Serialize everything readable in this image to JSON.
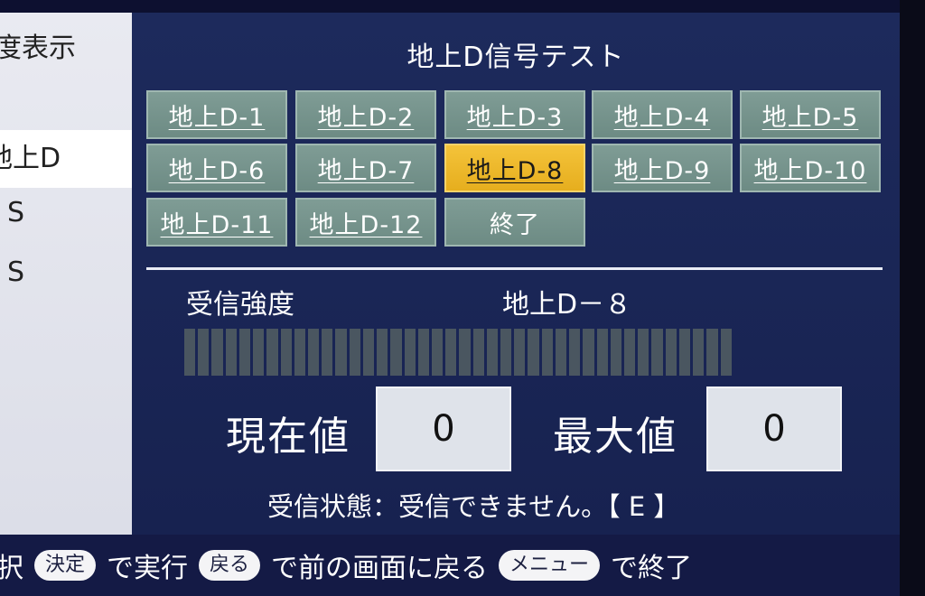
{
  "sidebar": {
    "items": [
      {
        "label": "度表示"
      },
      {
        "label": "地上D"
      },
      {
        "label": "S"
      },
      {
        "label": "S"
      }
    ]
  },
  "panel": {
    "title": "地上D信号テスト",
    "buttons": [
      {
        "label": "地上D-1"
      },
      {
        "label": "地上D-2"
      },
      {
        "label": "地上D-3"
      },
      {
        "label": "地上D-4"
      },
      {
        "label": "地上D-5"
      },
      {
        "label": "地上D-6"
      },
      {
        "label": "地上D-7"
      },
      {
        "label": "地上D-8"
      },
      {
        "label": "地上D-9"
      },
      {
        "label": "地上D-10"
      },
      {
        "label": "地上D-11"
      },
      {
        "label": "地上D-12"
      },
      {
        "label": "終了"
      }
    ],
    "selected_index": 7,
    "signal_label": "受信強度",
    "channel_name": "地上D－８",
    "signal_strength": 0,
    "current_label": "現在値",
    "current_value": "0",
    "max_label": "最大値",
    "max_value": "0",
    "status": "受信状態：受信できません。【 E 】"
  },
  "helpbar": {
    "select_suffix": "択",
    "kettei": "決定",
    "run": "で実行",
    "modoru": "戻る",
    "back": "で前の画面に戻る",
    "menu": "メニュー",
    "exit": "で終了"
  },
  "colors": {
    "panel_bg": "#1d2a5c",
    "button": "#7f9c95",
    "button_selected": "#f4c33a",
    "meter_segment": "#4a5660"
  }
}
